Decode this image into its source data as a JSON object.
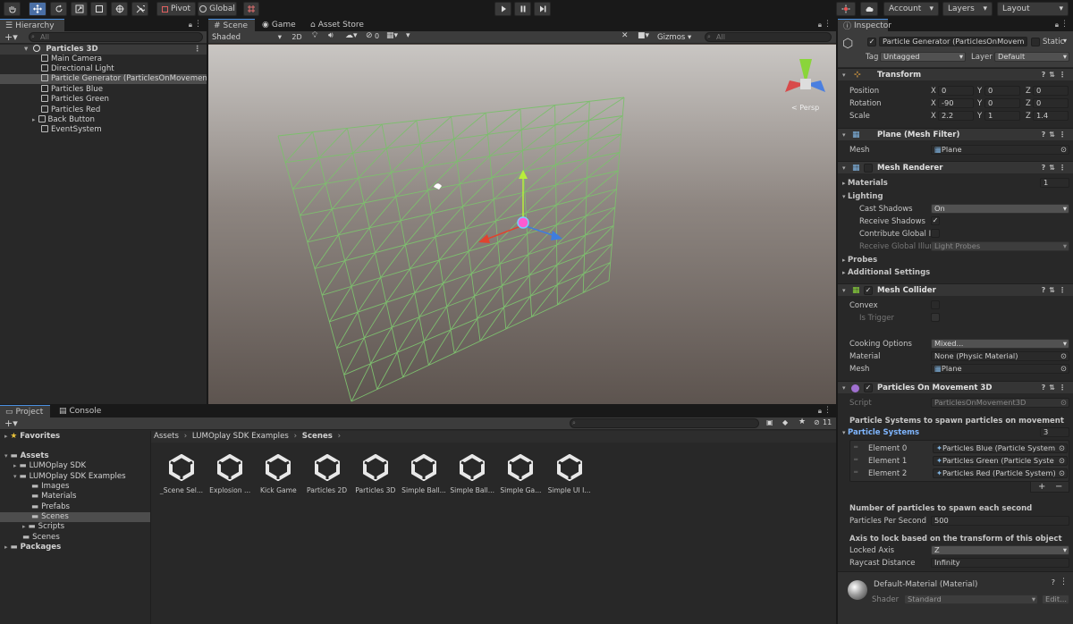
{
  "toolbar": {
    "pivot": "Pivot",
    "global": "Global",
    "account": "Account",
    "layers": "Layers",
    "layout": "Layout"
  },
  "hierarchy": {
    "tab": "Hierarchy",
    "search_placeholder": "All",
    "scene": "Particles 3D",
    "items": [
      "Main Camera",
      "Directional Light",
      "Particle Generator (ParticlesOnMovement3",
      "Particles Blue",
      "Particles Green",
      "Particles Red",
      "Back Button",
      "EventSystem"
    ]
  },
  "scene_view": {
    "tabs": [
      "Scene",
      "Game",
      "Asset Store"
    ],
    "shading": "Shaded",
    "mode_2d": "2D",
    "gizmo_count": "0",
    "gizmos": "Gizmos",
    "search_placeholder": "All",
    "persp": "< Persp",
    "grid_color": "#7dbe6e"
  },
  "project": {
    "tabs": [
      "Project",
      "Console"
    ],
    "tree": {
      "favorites": "Favorites",
      "assets": "Assets",
      "sdk": "LUMOplay SDK",
      "examples": "LUMOplay SDK Examples",
      "images": "Images",
      "materials": "Materials",
      "prefabs": "Prefabs",
      "scenes": "Scenes",
      "scripts": "Scripts",
      "scenes_root": "Scenes",
      "packages": "Packages"
    },
    "breadcrumb": [
      "Assets",
      "LUMOplay SDK Examples",
      "Scenes"
    ],
    "hidden_count": "11",
    "assets": [
      "_Scene Sel...",
      "Explosion ...",
      "Kick Game",
      "Particles 2D",
      "Particles 3D",
      "Simple Ball...",
      "Simple Ball...",
      "Simple Ga...",
      "Simple UI I..."
    ]
  },
  "inspector": {
    "tab": "Inspector",
    "object_name": "Particle Generator (ParticlesOnMovem",
    "static": "Static",
    "tag_label": "Tag",
    "tag_value": "Untagged",
    "layer_label": "Layer",
    "layer_value": "Default",
    "transform": {
      "title": "Transform",
      "position": "Position",
      "pos": [
        "0",
        "0",
        "0"
      ],
      "rotation": "Rotation",
      "rot": [
        "-90",
        "0",
        "0"
      ],
      "scale": "Scale",
      "scl": [
        "2.2",
        "1",
        "1.4"
      ]
    },
    "mesh_filter": {
      "title": "Plane (Mesh Filter)",
      "mesh_label": "Mesh",
      "mesh_value": "Plane"
    },
    "mesh_renderer": {
      "title": "Mesh Renderer",
      "materials": "Materials",
      "materials_count": "1",
      "lighting": "Lighting",
      "cast_shadows": "Cast Shadows",
      "cast_shadows_value": "On",
      "receive_shadows": "Receive Shadows",
      "contribute_gi": "Contribute Global Ill",
      "receive_gi": "Receive Global Illum",
      "receive_gi_value": "Light Probes",
      "probes": "Probes",
      "additional": "Additional Settings"
    },
    "mesh_collider": {
      "title": "Mesh Collider",
      "convex": "Convex",
      "is_trigger": "Is Trigger",
      "cooking": "Cooking Options",
      "cooking_value": "Mixed...",
      "material": "Material",
      "material_value": "None (Physic Material)",
      "mesh": "Mesh",
      "mesh_value": "Plane"
    },
    "particles_component": {
      "title": "Particles On Movement 3D",
      "script_label": "Script",
      "script_value": "ParticlesOnMovement3D",
      "spawn_header": "Particle Systems to spawn particles on movement",
      "systems_label": "Particle Systems",
      "systems_count": "3",
      "elements": [
        {
          "label": "Element 0",
          "value": "Particles Blue (Particle System"
        },
        {
          "label": "Element 1",
          "value": "Particles Green (Particle Syste"
        },
        {
          "label": "Element 2",
          "value": "Particles Red (Particle System)"
        }
      ],
      "per_second_header": "Number of particles to spawn each second",
      "per_second_label": "Particles Per Second",
      "per_second_value": "500",
      "axis_header": "Axis to lock based on the transform of this object",
      "locked_axis": "Locked Axis",
      "locked_axis_value": "Z",
      "raycast": "Raycast Distance",
      "raycast_value": "Infinity"
    },
    "material": {
      "title": "Default-Material (Material)",
      "shader_label": "Shader",
      "shader_value": "Standard",
      "edit": "Edit..."
    }
  }
}
